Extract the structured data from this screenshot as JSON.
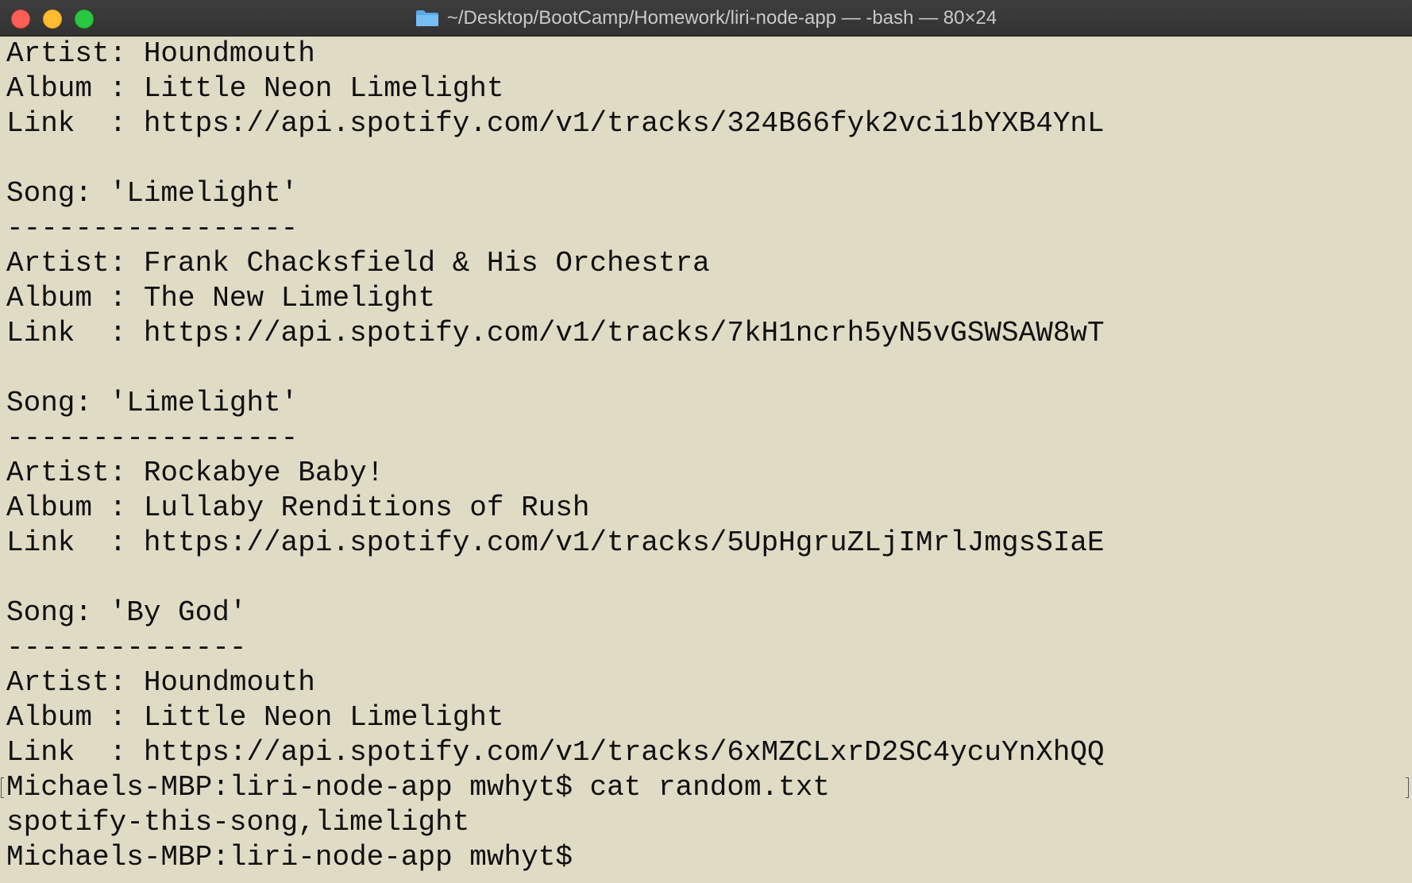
{
  "window": {
    "title": "~/Desktop/BootCamp/Homework/liri-node-app — -bash — 80×24",
    "icon": "folder-icon",
    "background": "#dfdbc5",
    "text_color": "#101010"
  },
  "terminal": {
    "lines": [
      "Artist: Houndmouth",
      "Album : Little Neon Limelight",
      "Link  : https://api.spotify.com/v1/tracks/324B66fyk2vci1bYXB4YnL",
      "",
      "Song: 'Limelight'",
      "-----------------",
      "Artist: Frank Chacksfield & His Orchestra",
      "Album : The New Limelight",
      "Link  : https://api.spotify.com/v1/tracks/7kH1ncrh5yN5vGSWSAW8wT",
      "",
      "Song: 'Limelight'",
      "-----------------",
      "Artist: Rockabye Baby!",
      "Album : Lullaby Renditions of Rush",
      "Link  : https://api.spotify.com/v1/tracks/5UpHgruZLjIMrlJmgsSIaE",
      "",
      "Song: 'By God'",
      "--------------",
      "Artist: Houndmouth",
      "Album : Little Neon Limelight",
      "Link  : https://api.spotify.com/v1/tracks/6xMZCLxrD2SC4ycuYnXhQQ",
      "Michaels-MBP:liri-node-app mwhyt$ cat random.txt",
      "spotify-this-song,limelight",
      "Michaels-MBP:liri-node-app mwhyt$"
    ]
  }
}
